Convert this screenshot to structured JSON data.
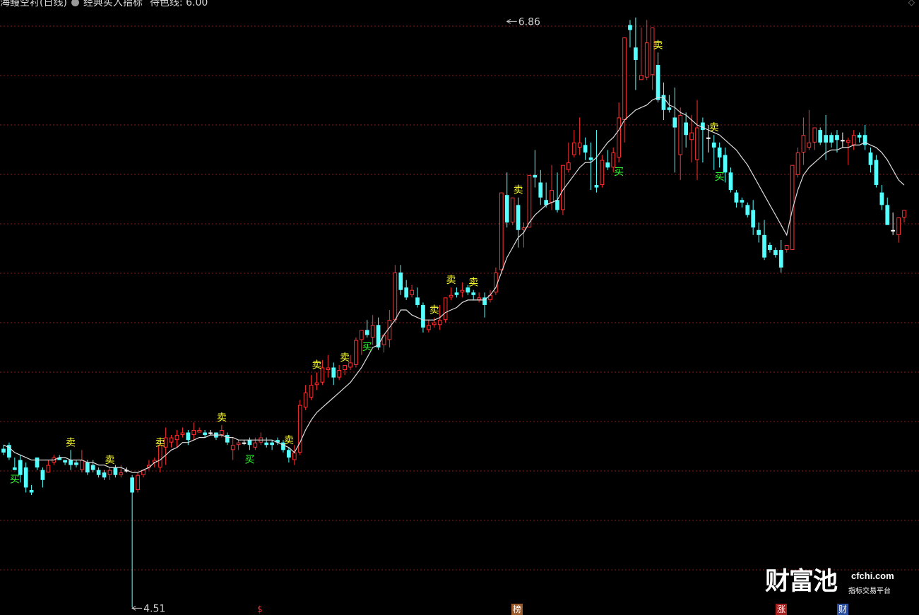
{
  "header": {
    "stock_title": "海鳗空衬(日线)",
    "indicator_name": "经典买入指标",
    "param_text": "待色线: 6.00"
  },
  "watermark": {
    "chinese": "财富池",
    "site": "cfchi.com",
    "subtitle": "指标交易平台"
  },
  "badges": {
    "dollar": "$",
    "bang": "榜",
    "zhang": "涨",
    "cai": "财"
  },
  "colors": {
    "up": "#ff3030",
    "down": "#54ffff",
    "flat": "#ffffff",
    "ma": "#dcdcdc",
    "grid": "#8a1e1e",
    "buy_signal": "#2eff2e",
    "sell_signal": "#ffff30",
    "annotation": "#d0d0d0"
  },
  "chart_data": {
    "type": "candlestick",
    "ylim": [
      4.48,
      6.94
    ],
    "grid": "horizontal dashed",
    "candles": [
      [
        5.145,
        5.16,
        5.13,
        5.12
      ],
      [
        5.16,
        5.17,
        5.11,
        5.1
      ],
      [
        5.07,
        5.11,
        5.06,
        5.06
      ],
      [
        5.1,
        5.12,
        5.04,
        5.01
      ],
      [
        5.07,
        5.09,
        4.99,
        4.97
      ],
      [
        4.98,
        5.0,
        4.97,
        4.96
      ],
      [
        5.11,
        5.11,
        5.07,
        5.06
      ],
      [
        5.06,
        5.07,
        5.02,
        4.99
      ],
      [
        5.05,
        5.1,
        5.08,
        5.05
      ],
      [
        5.09,
        5.12,
        5.11,
        5.08
      ],
      [
        5.11,
        5.12,
        5.1,
        5.1
      ],
      [
        5.1,
        5.1,
        5.09,
        5.08
      ],
      [
        5.1,
        5.14,
        5.08,
        5.06
      ],
      [
        5.09,
        5.1,
        5.08,
        5.07
      ],
      [
        5.06,
        5.14,
        5.1,
        5.05
      ],
      [
        5.09,
        5.1,
        5.05,
        5.04
      ],
      [
        5.08,
        5.1,
        5.06,
        5.05
      ],
      [
        5.06,
        5.07,
        5.04,
        5.03
      ],
      [
        5.05,
        5.06,
        5.03,
        5.02
      ],
      [
        5.04,
        5.07,
        5.06,
        5.02
      ],
      [
        5.07,
        5.08,
        5.04,
        5.03
      ],
      [
        5.04,
        5.08,
        5.05,
        5.03
      ],
      [
        5.06,
        5.07,
        5.06,
        5.05
      ],
      [
        5.03,
        5.04,
        4.97,
        4.51
      ],
      [
        4.98,
        5.05,
        5.04,
        4.97
      ],
      [
        5.04,
        5.06,
        5.06,
        5.03
      ],
      [
        5.07,
        5.1,
        5.08,
        5.06
      ],
      [
        5.09,
        5.11,
        5.1,
        5.07
      ],
      [
        5.07,
        5.14,
        5.16,
        5.05
      ],
      [
        5.15,
        5.23,
        5.19,
        5.08
      ],
      [
        5.17,
        5.2,
        5.19,
        5.15
      ],
      [
        5.18,
        5.22,
        5.2,
        5.15
      ],
      [
        5.2,
        5.23,
        5.21,
        5.19
      ],
      [
        5.21,
        5.22,
        5.18,
        5.16
      ],
      [
        5.2,
        5.25,
        5.22,
        5.18
      ],
      [
        5.21,
        5.23,
        5.22,
        5.21
      ],
      [
        5.21,
        5.22,
        5.2,
        5.19
      ],
      [
        5.21,
        5.22,
        5.21,
        5.2
      ],
      [
        5.21,
        5.21,
        5.19,
        5.18
      ],
      [
        5.2,
        5.24,
        5.22,
        5.19
      ],
      [
        5.2,
        5.21,
        5.17,
        5.16
      ],
      [
        5.14,
        5.19,
        5.16,
        5.1
      ],
      [
        5.16,
        5.18,
        5.17,
        5.14
      ],
      [
        5.17,
        5.18,
        5.17,
        5.16
      ],
      [
        5.18,
        5.19,
        5.16,
        5.14
      ],
      [
        5.15,
        5.19,
        5.17,
        5.14
      ],
      [
        5.17,
        5.21,
        5.19,
        5.16
      ],
      [
        5.17,
        5.19,
        5.16,
        5.15
      ],
      [
        5.17,
        5.18,
        5.16,
        5.14
      ],
      [
        5.18,
        5.19,
        5.17,
        5.16
      ],
      [
        5.17,
        5.18,
        5.14,
        5.13
      ],
      [
        5.14,
        5.15,
        5.11,
        5.09
      ],
      [
        5.1,
        5.16,
        5.13,
        5.08
      ],
      [
        5.13,
        5.34,
        5.32,
        5.12
      ],
      [
        5.31,
        5.4,
        5.37,
        5.3
      ],
      [
        5.35,
        5.44,
        5.4,
        5.34
      ],
      [
        5.4,
        5.45,
        5.41,
        5.38
      ],
      [
        5.41,
        5.5,
        5.47,
        5.4
      ],
      [
        5.46,
        5.52,
        5.47,
        5.43
      ],
      [
        5.47,
        5.49,
        5.43,
        5.4
      ],
      [
        5.43,
        5.48,
        5.46,
        5.42
      ],
      [
        5.46,
        5.48,
        5.48,
        5.44
      ],
      [
        5.47,
        5.52,
        5.49,
        5.46
      ],
      [
        5.48,
        5.59,
        5.58,
        5.47
      ],
      [
        5.58,
        5.61,
        5.62,
        5.52
      ],
      [
        5.62,
        5.66,
        5.6,
        5.59
      ],
      [
        5.59,
        5.68,
        5.64,
        5.56
      ],
      [
        5.64,
        5.67,
        5.55,
        5.54
      ],
      [
        5.56,
        5.6,
        5.6,
        5.53
      ],
      [
        5.58,
        5.7,
        5.66,
        5.55
      ],
      [
        5.66,
        5.88,
        5.85,
        5.65
      ],
      [
        5.85,
        5.88,
        5.78,
        5.76
      ],
      [
        5.79,
        5.82,
        5.75,
        5.74
      ],
      [
        5.76,
        5.8,
        5.78,
        5.75
      ],
      [
        5.75,
        5.79,
        5.72,
        5.71
      ],
      [
        5.72,
        5.73,
        5.63,
        5.61
      ],
      [
        5.62,
        5.66,
        5.64,
        5.61
      ],
      [
        5.64,
        5.67,
        5.65,
        5.63
      ],
      [
        5.64,
        5.72,
        5.66,
        5.62
      ],
      [
        5.66,
        5.74,
        5.75,
        5.65
      ],
      [
        5.75,
        5.79,
        5.76,
        5.74
      ],
      [
        5.77,
        5.79,
        5.76,
        5.75
      ],
      [
        5.77,
        5.81,
        5.78,
        5.75
      ],
      [
        5.79,
        5.8,
        5.77,
        5.76
      ],
      [
        5.77,
        5.78,
        5.76,
        5.74
      ],
      [
        5.74,
        5.77,
        5.75,
        5.73
      ],
      [
        5.75,
        5.77,
        5.72,
        5.67
      ],
      [
        5.74,
        5.78,
        5.76,
        5.73
      ],
      [
        5.77,
        5.87,
        5.85,
        5.76
      ],
      [
        5.86,
        6.17,
        6.17,
        5.85
      ],
      [
        6.16,
        6.25,
        6.05,
        6.03
      ],
      [
        6.05,
        6.15,
        6.15,
        6.04
      ],
      [
        6.12,
        6.15,
        6.02,
        5.95
      ],
      [
        6.02,
        6.05,
        6.03,
        5.95
      ],
      [
        6.03,
        6.23,
        6.24,
        6.03
      ],
      [
        6.24,
        6.34,
        6.23,
        6.19
      ],
      [
        6.21,
        6.26,
        6.15,
        6.12
      ],
      [
        6.14,
        6.21,
        6.12,
        6.11
      ],
      [
        6.13,
        6.28,
        6.18,
        6.1
      ],
      [
        6.14,
        6.25,
        6.1,
        6.09
      ],
      [
        6.1,
        6.27,
        6.28,
        6.08
      ],
      [
        6.26,
        6.37,
        6.29,
        6.25
      ],
      [
        6.32,
        6.42,
        6.37,
        6.31
      ],
      [
        6.35,
        6.47,
        6.37,
        6.32
      ],
      [
        6.36,
        6.39,
        6.33,
        6.3
      ],
      [
        6.31,
        6.37,
        6.3,
        6.18
      ],
      [
        6.2,
        6.42,
        6.19,
        6.17
      ],
      [
        6.2,
        6.32,
        6.3,
        6.19
      ],
      [
        6.29,
        6.34,
        6.27,
        6.26
      ],
      [
        6.27,
        6.35,
        6.33,
        6.25
      ],
      [
        6.31,
        6.53,
        6.47,
        6.29
      ],
      [
        6.46,
        6.7,
        6.79,
        6.37
      ],
      [
        6.84,
        6.86,
        6.82,
        6.75
      ],
      [
        6.75,
        6.87,
        6.7,
        6.58
      ],
      [
        6.62,
        6.83,
        6.64,
        6.62
      ],
      [
        6.63,
        6.86,
        6.77,
        6.62
      ],
      [
        6.64,
        6.82,
        6.83,
        6.58
      ],
      [
        6.68,
        6.73,
        6.54,
        6.53
      ],
      [
        6.56,
        6.61,
        6.5,
        6.46
      ],
      [
        6.51,
        6.56,
        6.5,
        6.49
      ],
      [
        6.47,
        6.59,
        6.43,
        6.25
      ],
      [
        6.32,
        6.51,
        6.48,
        6.22
      ],
      [
        6.45,
        6.49,
        6.4,
        6.35
      ],
      [
        6.38,
        6.48,
        6.41,
        6.29
      ],
      [
        6.3,
        6.54,
        6.43,
        6.22
      ],
      [
        6.45,
        6.47,
        6.42,
        6.29
      ],
      [
        6.39,
        6.44,
        6.39,
        6.33
      ],
      [
        6.37,
        6.4,
        6.35,
        6.26
      ],
      [
        6.35,
        6.37,
        6.31,
        6.27
      ],
      [
        6.32,
        6.35,
        6.25,
        6.21
      ],
      [
        6.25,
        6.27,
        6.18,
        6.17
      ],
      [
        6.17,
        6.18,
        6.13,
        6.11
      ],
      [
        6.14,
        6.15,
        6.13,
        6.11
      ],
      [
        6.12,
        6.13,
        6.08,
        6.07
      ],
      [
        6.1,
        6.14,
        6.03,
        6.0
      ],
      [
        6.02,
        6.05,
        6.0,
        5.97
      ],
      [
        6.0,
        6.06,
        5.91,
        5.9
      ],
      [
        5.96,
        5.97,
        5.94,
        5.93
      ],
      [
        5.94,
        5.95,
        5.92,
        5.91
      ],
      [
        5.94,
        5.98,
        5.87,
        5.85
      ],
      [
        5.94,
        5.96,
        5.96,
        5.93
      ],
      [
        5.94,
        6.28,
        6.28,
        6.2
      ],
      [
        6.24,
        6.35,
        6.33,
        6.23
      ],
      [
        6.33,
        6.47,
        6.4,
        6.28
      ],
      [
        6.35,
        6.5,
        6.37,
        6.34
      ],
      [
        6.37,
        6.41,
        6.43,
        6.34
      ],
      [
        6.42,
        6.43,
        6.37,
        6.36
      ],
      [
        6.4,
        6.48,
        6.37,
        6.3
      ],
      [
        6.4,
        6.41,
        6.37,
        6.35
      ],
      [
        6.4,
        6.42,
        6.38,
        6.33
      ],
      [
        6.38,
        6.41,
        6.38,
        6.35
      ],
      [
        6.37,
        6.39,
        6.38,
        6.28
      ],
      [
        6.36,
        6.42,
        6.4,
        6.34
      ],
      [
        6.4,
        6.41,
        6.39,
        6.37
      ],
      [
        6.4,
        6.44,
        6.36,
        6.34
      ],
      [
        6.33,
        6.35,
        6.28,
        6.25
      ],
      [
        6.3,
        6.32,
        6.2,
        6.19
      ],
      [
        6.17,
        6.2,
        6.12,
        6.1
      ],
      [
        6.12,
        6.15,
        6.04,
        6.04
      ],
      [
        6.02,
        6.09,
        6.02,
        6.0
      ],
      [
        6.0,
        6.02,
        6.07,
        5.97
      ],
      [
        6.07,
        6.1,
        6.1,
        6.05
      ]
    ],
    "ma_line": [
      5.16,
      5.15,
      5.13,
      5.12,
      5.11,
      5.1,
      5.1,
      5.1,
      5.1,
      5.1,
      5.11,
      5.11,
      5.1,
      5.1,
      5.1,
      5.09,
      5.09,
      5.08,
      5.08,
      5.07,
      5.07,
      5.07,
      5.06,
      5.05,
      5.05,
      5.06,
      5.07,
      5.09,
      5.1,
      5.12,
      5.14,
      5.15,
      5.17,
      5.17,
      5.18,
      5.19,
      5.19,
      5.2,
      5.2,
      5.2,
      5.19,
      5.19,
      5.18,
      5.18,
      5.18,
      5.18,
      5.18,
      5.18,
      5.18,
      5.17,
      5.16,
      5.15,
      5.13,
      5.17,
      5.22,
      5.26,
      5.29,
      5.31,
      5.33,
      5.35,
      5.37,
      5.39,
      5.41,
      5.44,
      5.47,
      5.51,
      5.55,
      5.56,
      5.6,
      5.63,
      5.66,
      5.7,
      5.7,
      5.68,
      5.67,
      5.66,
      5.66,
      5.66,
      5.67,
      5.69,
      5.7,
      5.71,
      5.73,
      5.74,
      5.74,
      5.74,
      5.74,
      5.76,
      5.79,
      5.85,
      5.91,
      5.95,
      5.99,
      6.01,
      6.05,
      6.08,
      6.1,
      6.12,
      6.13,
      6.14,
      6.18,
      6.21,
      6.24,
      6.27,
      6.29,
      6.29,
      6.31,
      6.34,
      6.37,
      6.39,
      6.42,
      6.46,
      6.48,
      6.5,
      6.51,
      6.52,
      6.54,
      6.55,
      6.55,
      6.52,
      6.51,
      6.49,
      6.48,
      6.46,
      6.44,
      6.43,
      6.42,
      6.41,
      6.4,
      6.38,
      6.36,
      6.34,
      6.31,
      6.28,
      6.24,
      6.2,
      6.16,
      6.12,
      6.08,
      6.04,
      6.0,
      6.1,
      6.18,
      6.24,
      6.27,
      6.29,
      6.31,
      6.33,
      6.34,
      6.34,
      6.35,
      6.35,
      6.36,
      6.36,
      6.37,
      6.36,
      6.35,
      6.33,
      6.3,
      6.26,
      6.22,
      6.2
    ],
    "signals": [
      {
        "index": 2,
        "label": "买",
        "type": "buy",
        "pos": "below"
      },
      {
        "index": 12,
        "label": "卖",
        "type": "sell",
        "pos": "above"
      },
      {
        "index": 19,
        "label": "卖",
        "type": "sell",
        "pos": "above"
      },
      {
        "index": 28,
        "label": "卖",
        "type": "sell",
        "pos": "above"
      },
      {
        "index": 39,
        "label": "卖",
        "type": "sell",
        "pos": "above"
      },
      {
        "index": 44,
        "label": "买",
        "type": "buy",
        "pos": "below"
      },
      {
        "index": 51,
        "label": "卖",
        "type": "sell",
        "pos": "above"
      },
      {
        "index": 56,
        "label": "卖",
        "type": "sell",
        "pos": "above"
      },
      {
        "index": 61,
        "label": "卖",
        "type": "sell",
        "pos": "above"
      },
      {
        "index": 65,
        "label": "买",
        "type": "buy",
        "pos": "below"
      },
      {
        "index": 77,
        "label": "卖",
        "type": "sell",
        "pos": "above"
      },
      {
        "index": 80,
        "label": "卖",
        "type": "sell",
        "pos": "above"
      },
      {
        "index": 84,
        "label": "卖",
        "type": "sell",
        "pos": "above"
      },
      {
        "index": 92,
        "label": "卖",
        "type": "sell",
        "pos": "above"
      },
      {
        "index": 110,
        "label": "买",
        "type": "buy",
        "pos": "below"
      },
      {
        "index": 117,
        "label": "卖",
        "type": "sell",
        "pos": "above"
      },
      {
        "index": 127,
        "label": "卖",
        "type": "sell",
        "pos": "above"
      },
      {
        "index": 128,
        "label": "买",
        "type": "buy",
        "pos": "below"
      }
    ],
    "annotations": {
      "high": {
        "index": 90,
        "value": 6.86,
        "label": "6.86"
      },
      "low": {
        "index": 23,
        "value": 4.51,
        "label": "4.51"
      }
    }
  }
}
